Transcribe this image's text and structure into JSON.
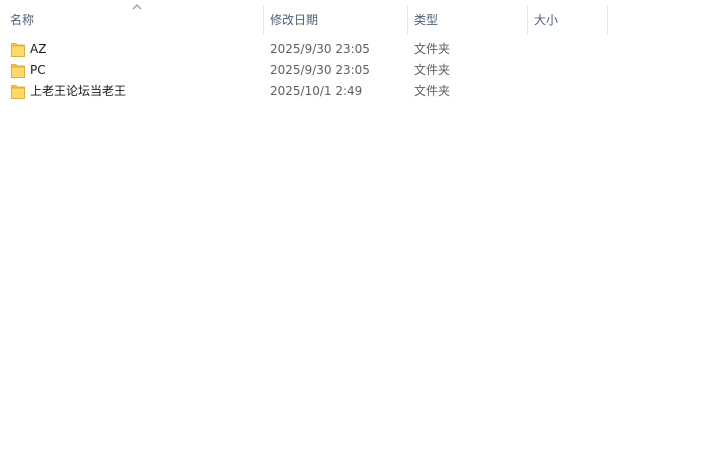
{
  "columns": {
    "name": "名称",
    "date": "修改日期",
    "type": "类型",
    "size": "大小"
  },
  "sort": {
    "column": "name",
    "icon": "chevron-up-icon"
  },
  "files": [
    {
      "name": "AZ",
      "date": "2025/9/30 23:05",
      "type": "文件夹",
      "size": "",
      "icon": "folder-icon"
    },
    {
      "name": "PC",
      "date": "2025/9/30 23:05",
      "type": "文件夹",
      "size": "",
      "icon": "folder-icon"
    },
    {
      "name": "上老王论坛当老王",
      "date": "2025/10/1 2:49",
      "type": "文件夹",
      "size": "",
      "icon": "folder-icon"
    }
  ],
  "colors": {
    "header_text": "#4c607a",
    "folder_body": "#ffd966",
    "folder_tab": "#f2c14e"
  }
}
